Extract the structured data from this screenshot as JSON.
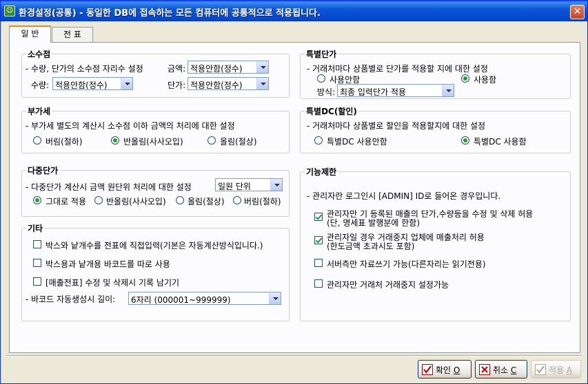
{
  "window": {
    "title": "환경설정(공통) - 동일한 DB에 접속하는 모든 컴퓨터에 공통적으로 적용됩니다.",
    "close_glyph": "✕"
  },
  "tabs": [
    {
      "label": "일 반"
    },
    {
      "label": "전 표"
    }
  ],
  "decimal": {
    "title": "소수점",
    "desc": "- 수량, 단가의 소수점 자리수 설정",
    "amount_label": "금액:",
    "amount_value": "적용안함(정수)",
    "qty_label": "수량:",
    "qty_value": "적용안함(정수)",
    "price_label": "단가:",
    "price_value": "적용안함(정수)"
  },
  "special_price": {
    "title": "특별단가",
    "desc": "- 거래처마다 상품별로 단가를 적용할 지에 대한 설정",
    "opt_off": "사용안함",
    "opt_on": "사용함",
    "method_label": "방식:",
    "method_value": "최종 입력단가 적용"
  },
  "vat": {
    "title": "부가세",
    "desc": "- 부가세 별도의 계산시 소수점 이하 금액의 처리에 대한 설정",
    "opt1": "버림(절하)",
    "opt2": "반올림(사사오입)",
    "opt3": "올림(절상)"
  },
  "special_dc": {
    "title": "특별DC(할인)",
    "desc": "- 거래처마다 상품별로 할인을 적용할지에 대한 설정",
    "opt_off": "특별DC 사용안함",
    "opt_on": "특별DC 사용함"
  },
  "multi_price": {
    "title": "다중단가",
    "desc": "- 다중단가 계산시 금액 원단위 처리에 대한 설정",
    "unit_value": "일원 단위",
    "opt1": "그대로 적용",
    "opt2": "반올림(사사오입)",
    "opt3": "올림(절상)",
    "opt4": "버림(절하)"
  },
  "misc": {
    "title": "기타",
    "chk1": "박스와 낱개수를 전표에 직접입력(기본은 자동계산방식입니다.)",
    "chk2": "박스용과 낱개용 바코드를 따로 사용",
    "chk3": "[매출전표] 수정 및 삭제시 기록 남기기",
    "barcode_label": "- 바코드 자동생성시 길이:",
    "barcode_value": "6자리  (000001~999999)"
  },
  "limits": {
    "title": "기능제한",
    "desc": "- 관리자란 로그인시 [ADMIN] ID로 들어온 경우입니다.",
    "chk1_line1": "관리자만 기 등록된 매출의 단가,수량등을 수정 및 삭제 허용",
    "chk1_line2": "(단, 명세표 발행분에 한함)",
    "chk2_line1": "관리자일 경우 거래중지 업체에 매출처리 허용",
    "chk2_line2": "(한도금액 초과시도 포함)",
    "chk3": "서버측만 자료쓰기 가능(다른자리는 읽기전용)",
    "chk4": "관리자만 거래처 거래중지 설정가능"
  },
  "buttons": {
    "ok_label": "확인",
    "ok_key": "O",
    "cancel_label": "취소",
    "cancel_key": "C",
    "apply_label": "적용",
    "apply_key": "A"
  }
}
